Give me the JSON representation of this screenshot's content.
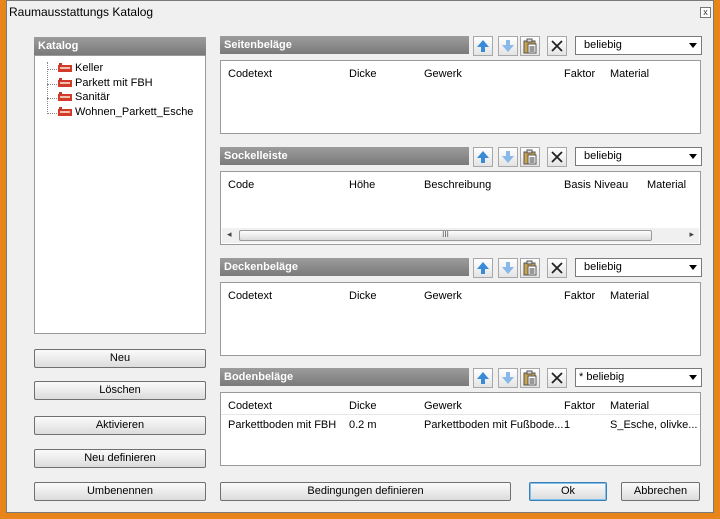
{
  "window": {
    "title": "Raumausstattungs Katalog",
    "close": "x"
  },
  "catalog": {
    "header": "Katalog",
    "items": [
      "Keller",
      "Parkett mit FBH",
      "Sanitär",
      "Wohnen_Parkett_Esche"
    ]
  },
  "left_buttons": {
    "new": "Neu",
    "delete": "Löschen",
    "activate": "Aktivieren",
    "redefine": "Neu definieren",
    "rename": "Umbenennen"
  },
  "sections": {
    "seitenbelaege": {
      "header": "Seitenbeläge",
      "filter": "beliebig",
      "columns": [
        "Codetext",
        "Dicke",
        "Gewerk",
        "Faktor",
        "Material"
      ]
    },
    "sockelleiste": {
      "header": "Sockelleiste",
      "filter": "beliebig",
      "columns": [
        "Code",
        "Höhe",
        "Beschreibung",
        "Basis Niveau",
        "Material"
      ],
      "scroll_thumb": "III"
    },
    "deckenbelaege": {
      "header": "Deckenbeläge",
      "filter": "beliebig",
      "columns": [
        "Codetext",
        "Dicke",
        "Gewerk",
        "Faktor",
        "Material"
      ]
    },
    "bodenbelaege": {
      "header": "Bodenbeläge",
      "filter": "* beliebig",
      "columns": [
        "Codetext",
        "Dicke",
        "Gewerk",
        "Faktor",
        "Material"
      ],
      "rows": [
        [
          "Parkettboden mit FBH",
          "0.2 m",
          "Parkettboden mit Fußbode...",
          "1",
          "S_Esche, olivke..."
        ]
      ]
    }
  },
  "bottom_buttons": {
    "conditions": "Bedingungen definieren",
    "ok": "Ok",
    "cancel": "Abbrechen"
  },
  "icons": [
    "move-up-icon",
    "move-down-icon",
    "paste-icon",
    "delete-icon",
    "catalog-item-icon"
  ],
  "colors": {
    "accent_border": "#e8841c",
    "header_bg": "#8a8a8a",
    "arrow_blue": "#3a8ad8"
  }
}
